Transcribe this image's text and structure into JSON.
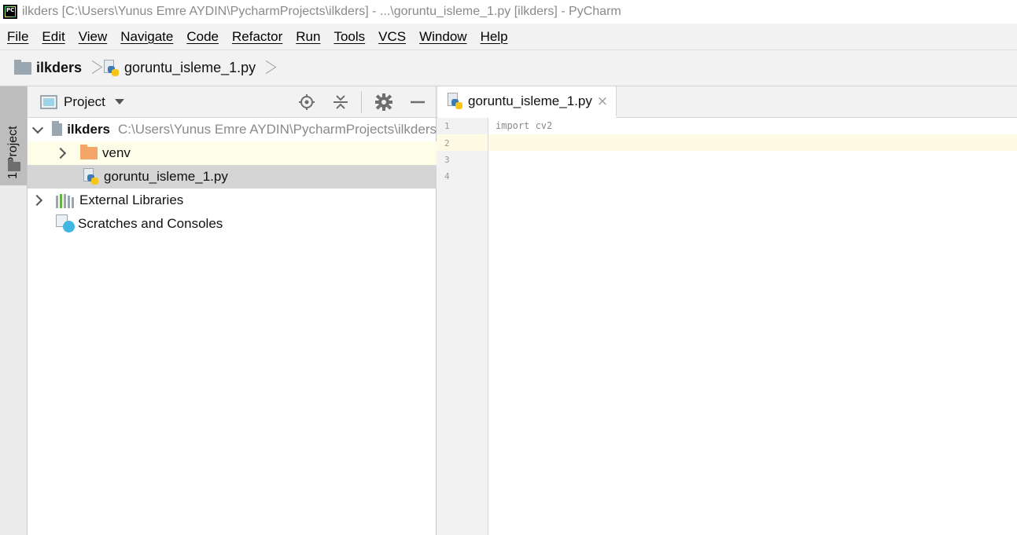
{
  "window": {
    "logo_text": "PC",
    "title": "ilkders [C:\\Users\\Yunus Emre AYDIN\\PycharmProjects\\ilkders] - ...\\goruntu_isleme_1.py [ilkders] - PyCharm"
  },
  "menu": [
    "File",
    "Edit",
    "View",
    "Navigate",
    "Code",
    "Refactor",
    "Run",
    "Tools",
    "VCS",
    "Window",
    "Help"
  ],
  "breadcrumb": {
    "project": "ilkders",
    "file": "goruntu_isleme_1.py"
  },
  "sidebar_stripe": {
    "label": "1: Project"
  },
  "project_panel": {
    "title": "Project",
    "tree": {
      "root_name": "ilkders",
      "root_path": "C:\\Users\\Yunus Emre AYDIN\\PycharmProjects\\ilkders",
      "venv": "venv",
      "file": "goruntu_isleme_1.py",
      "external_libraries": "External Libraries",
      "scratches": "Scratches and Consoles"
    }
  },
  "editor": {
    "tab_label": "goruntu_isleme_1.py",
    "tab_close": "×",
    "line_numbers": [
      "1",
      "2",
      "3",
      "4"
    ],
    "code_lines": [
      "import cv2",
      "",
      "",
      ""
    ]
  },
  "colors": {
    "current_line": "#fffae3",
    "selected_row": "#d5d5d5",
    "highlight_row": "#fdfde8",
    "folder_gray": "#9aa7b0",
    "folder_orange": "#f4a56a"
  }
}
